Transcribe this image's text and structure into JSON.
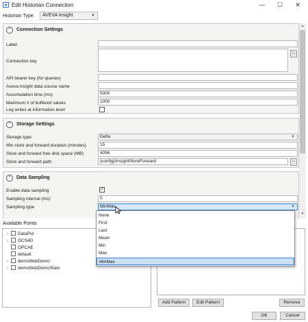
{
  "window": {
    "title": "Edit Historian Connection",
    "min": "—",
    "max": "☐",
    "close": "✕"
  },
  "historian_type": {
    "label": "Historian Type:",
    "value": "AVEVA Insight"
  },
  "connection": {
    "title": "Connection Settings",
    "label_label": "Label",
    "connection_key_label": "Connection key",
    "api_key_label": "API bearer key (for queries)",
    "datasource_label": "Aveva Insight data source name",
    "accum_label": "Accumulation time (ms)",
    "accum_value": "5000",
    "maxbuf_label": "Maximum # of buffered values",
    "maxbuf_value": "1000",
    "logwrites_label": "Log writes at information level"
  },
  "storage": {
    "title": "Storage Settings",
    "type_label": "Storage type",
    "type_value": "Delta",
    "minstore_label": "Min store and forward duration (minutes)",
    "minstore_value": "15",
    "freedisk_label": "Store and forward free disk space (MB)",
    "freedisk_value": "4096",
    "path_label": "Store and forward path",
    "path_value": "{config}\\InsightStoreForward"
  },
  "sampling": {
    "title": "Data Sampling",
    "enable_label": "Enable data sampling",
    "interval_label": "Sampling interval (ms)",
    "interval_value": "0",
    "type_label": "Sampling type",
    "type_value": "MinMax",
    "options": [
      "None",
      "First",
      "Last",
      "Mean",
      "Min",
      "Max",
      "MinMax"
    ]
  },
  "points": {
    "label": "Available Points",
    "items": [
      "DataPid",
      "OCS4D",
      "OPCAE",
      "default",
      "demoWebDemo",
      "demoWebDemoStats"
    ]
  },
  "buttons": {
    "add_pattern": "Add Pattern",
    "edit_pattern": "Edit Pattern",
    "remove": "Remove",
    "ok": "OK",
    "cancel": "Cancel",
    "ellipsis": "..."
  }
}
